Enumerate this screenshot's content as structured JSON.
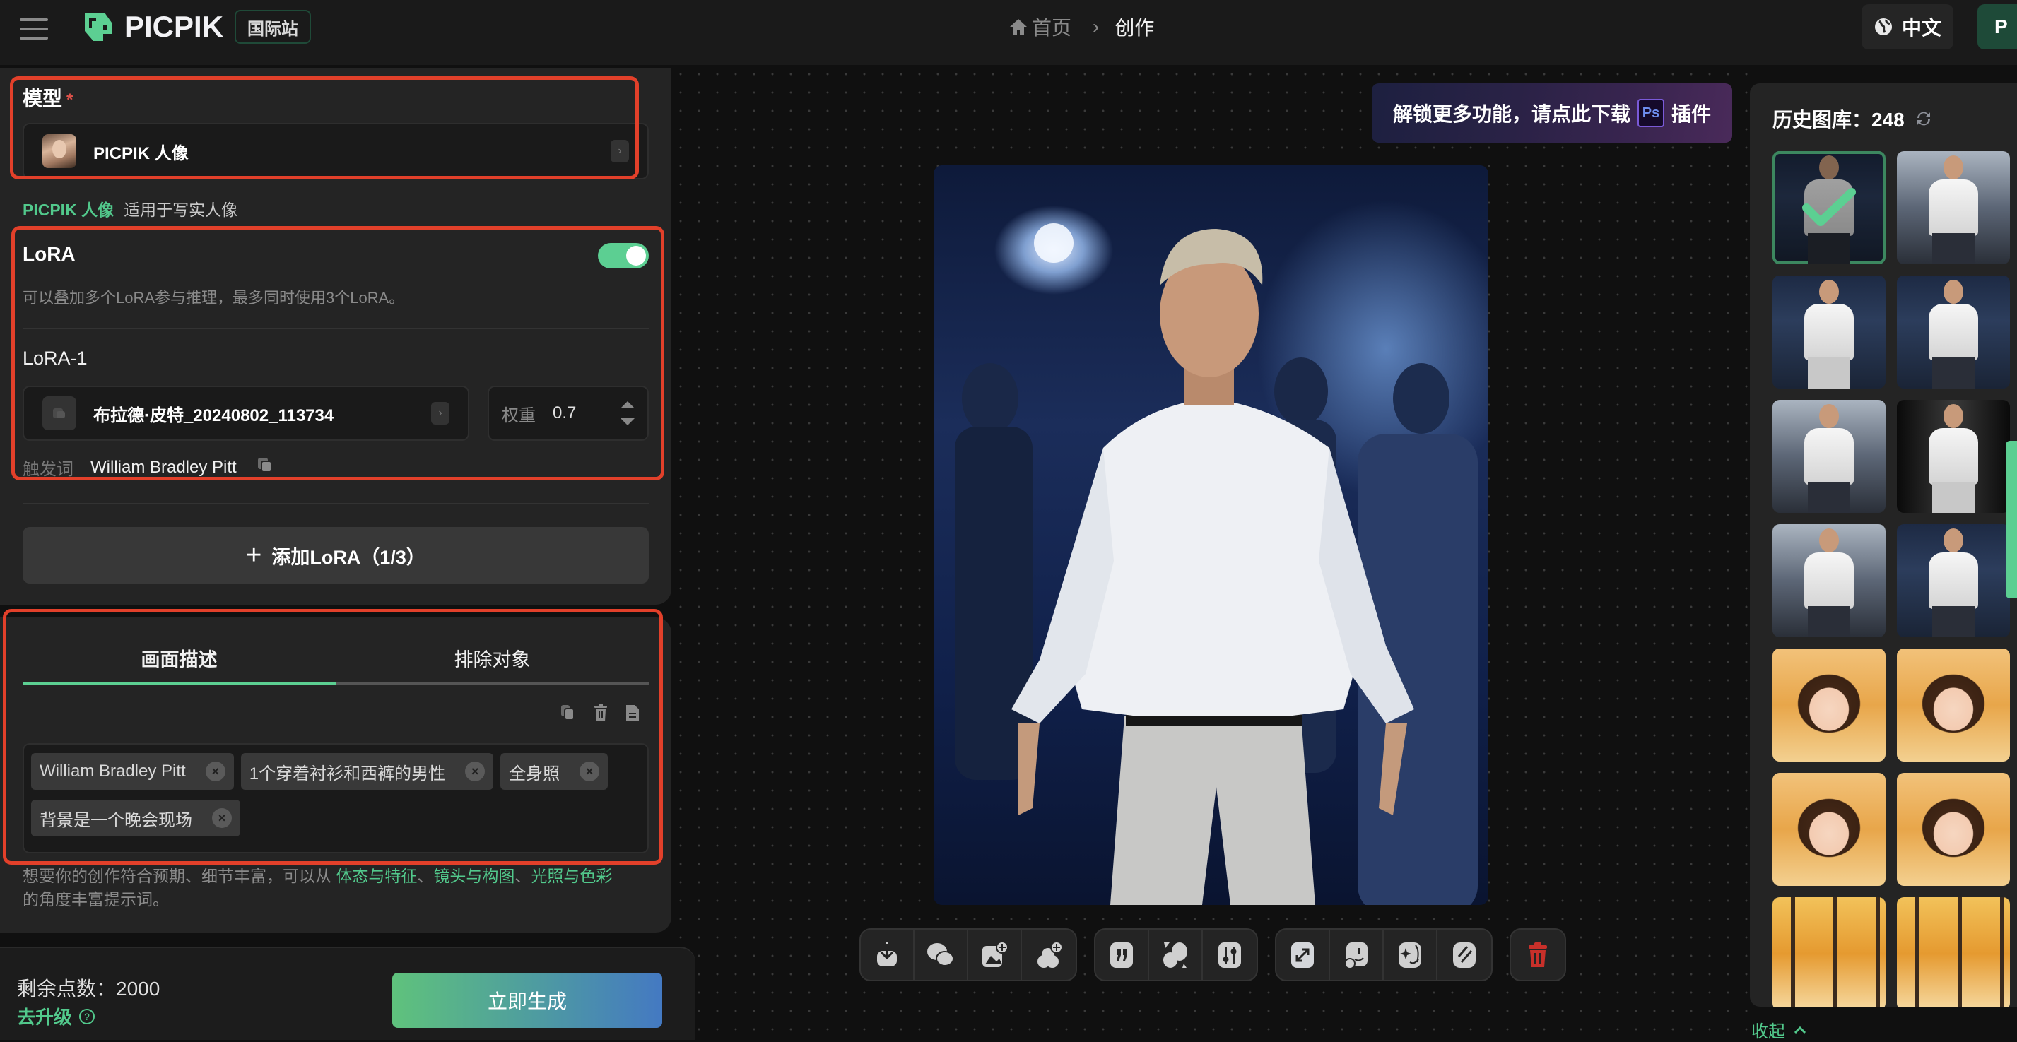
{
  "header": {
    "menu_icon": "hamburger-icon",
    "logo_text": "PICPIK",
    "region_badge": "国际站",
    "breadcrumb": [
      {
        "label": "首页",
        "icon": "home-icon"
      },
      {
        "label": "创作"
      }
    ],
    "language": {
      "label": "中文",
      "icon": "globe-icon"
    },
    "user_initial": "P"
  },
  "left_panel": {
    "model": {
      "label": "模型",
      "required_mark": "*",
      "selected_name": "PICPIK 人像",
      "desc_name": "PICPIK 人像",
      "desc_text": "适用于写实人像"
    },
    "lora": {
      "title": "LoRA",
      "enabled": true,
      "hint": "可以叠加多个LoRA参与推理，最多同时使用3个LoRA。",
      "items": [
        {
          "label": "LoRA-1",
          "name": "布拉德·皮特_20240802_113734",
          "weight_label": "权重",
          "weight": "0.7",
          "trigger_label": "触发词",
          "trigger_word": "William Bradley Pitt"
        }
      ],
      "add_button": "添加LoRA（1/3）"
    },
    "prompt": {
      "tabs": [
        {
          "label": "画面描述",
          "active": true
        },
        {
          "label": "排除对象",
          "active": false
        }
      ],
      "tags": [
        "William Bradley Pitt",
        "1个穿着衬衫和西裤的男性",
        "全身照",
        "背景是一个晚会现场"
      ],
      "tip_prefix": "想要你的创作符合预期、细节丰富，可以从 ",
      "tip_links": [
        "体态与特征",
        "镜头与构图",
        "光照与色彩"
      ],
      "tip_sep": "、",
      "tip_suffix": "的角度丰富提示词。"
    },
    "footer": {
      "points_label": "剩余点数：",
      "points_value": "2000",
      "upgrade_label": "去升级",
      "generate_button": "立即生成"
    }
  },
  "canvas": {
    "ps_banner": {
      "text_before": "解锁更多功能，请点此下载",
      "ps_label": "Ps",
      "text_after": "插件"
    },
    "toolbar_groups": [
      [
        "download-icon",
        "wechat-share-icon",
        "add-to-image-icon",
        "add-style-icon"
      ],
      [
        "quote-prompt-icon",
        "remix-icon",
        "adjust-params-icon"
      ],
      [
        "upscale-icon",
        "face-swap-icon",
        "face-retouch-icon",
        "remove-object-icon"
      ],
      [
        "delete-icon"
      ]
    ]
  },
  "history": {
    "title": "历史图库：",
    "count": "248",
    "selected_index": 0,
    "thumbnails": [
      "man",
      "man-light",
      "man",
      "man",
      "man-light",
      "man-bw",
      "man-light",
      "man",
      "girl",
      "girl",
      "girl",
      "girl",
      "forest",
      "forest"
    ],
    "collapse_label": "收起"
  },
  "colors": {
    "accent": "#5ccf92",
    "highlight_red": "#e2402a",
    "delete_red": "#c8302a"
  }
}
